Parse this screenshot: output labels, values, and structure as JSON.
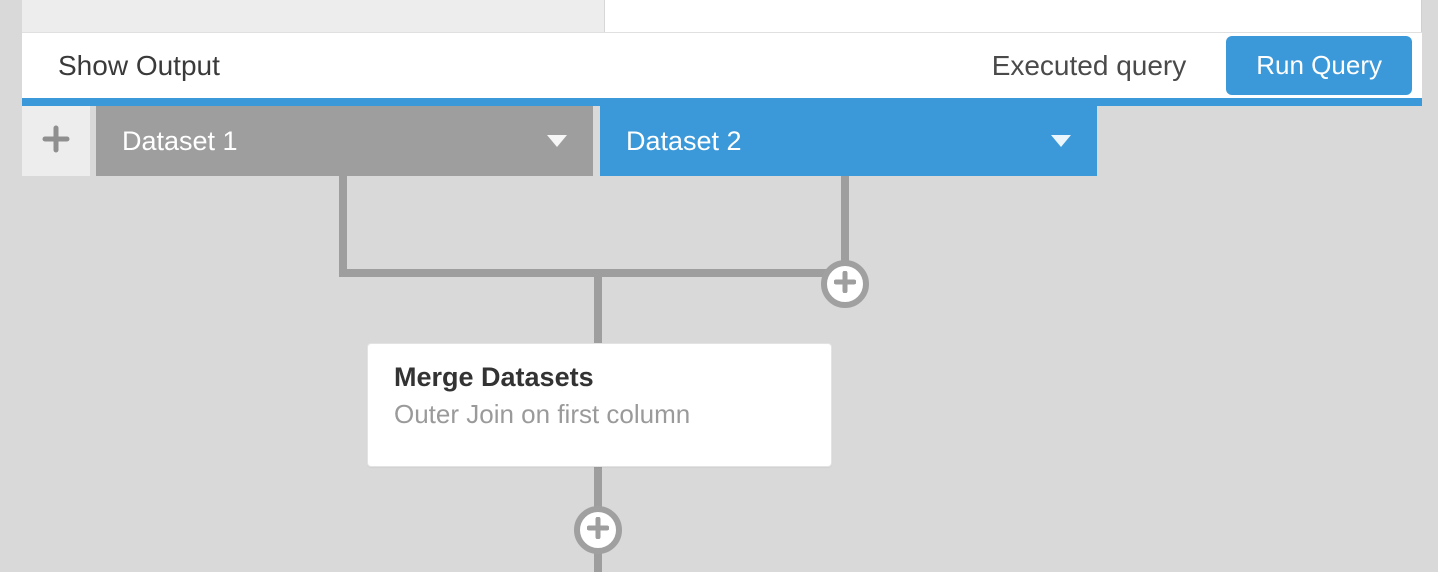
{
  "action_bar": {
    "show_output_label": "Show Output",
    "status_label": "Executed query",
    "run_button_label": "Run Query"
  },
  "tabs": {
    "add_icon": "plus-icon",
    "items": [
      {
        "label": "Dataset 1",
        "state": "inactive"
      },
      {
        "label": "Dataset 2",
        "state": "active"
      }
    ]
  },
  "flow": {
    "merge_node": {
      "title": "Merge Datasets",
      "subtitle": "Outer Join on first column"
    },
    "add_node_join_icon": "plus-icon",
    "add_node_bottom_icon": "plus-icon"
  },
  "colors": {
    "accent": "#3b99d9",
    "inactive_tab": "#9e9e9e",
    "connector": "#9e9e9e",
    "canvas": "#d9d9d9"
  }
}
